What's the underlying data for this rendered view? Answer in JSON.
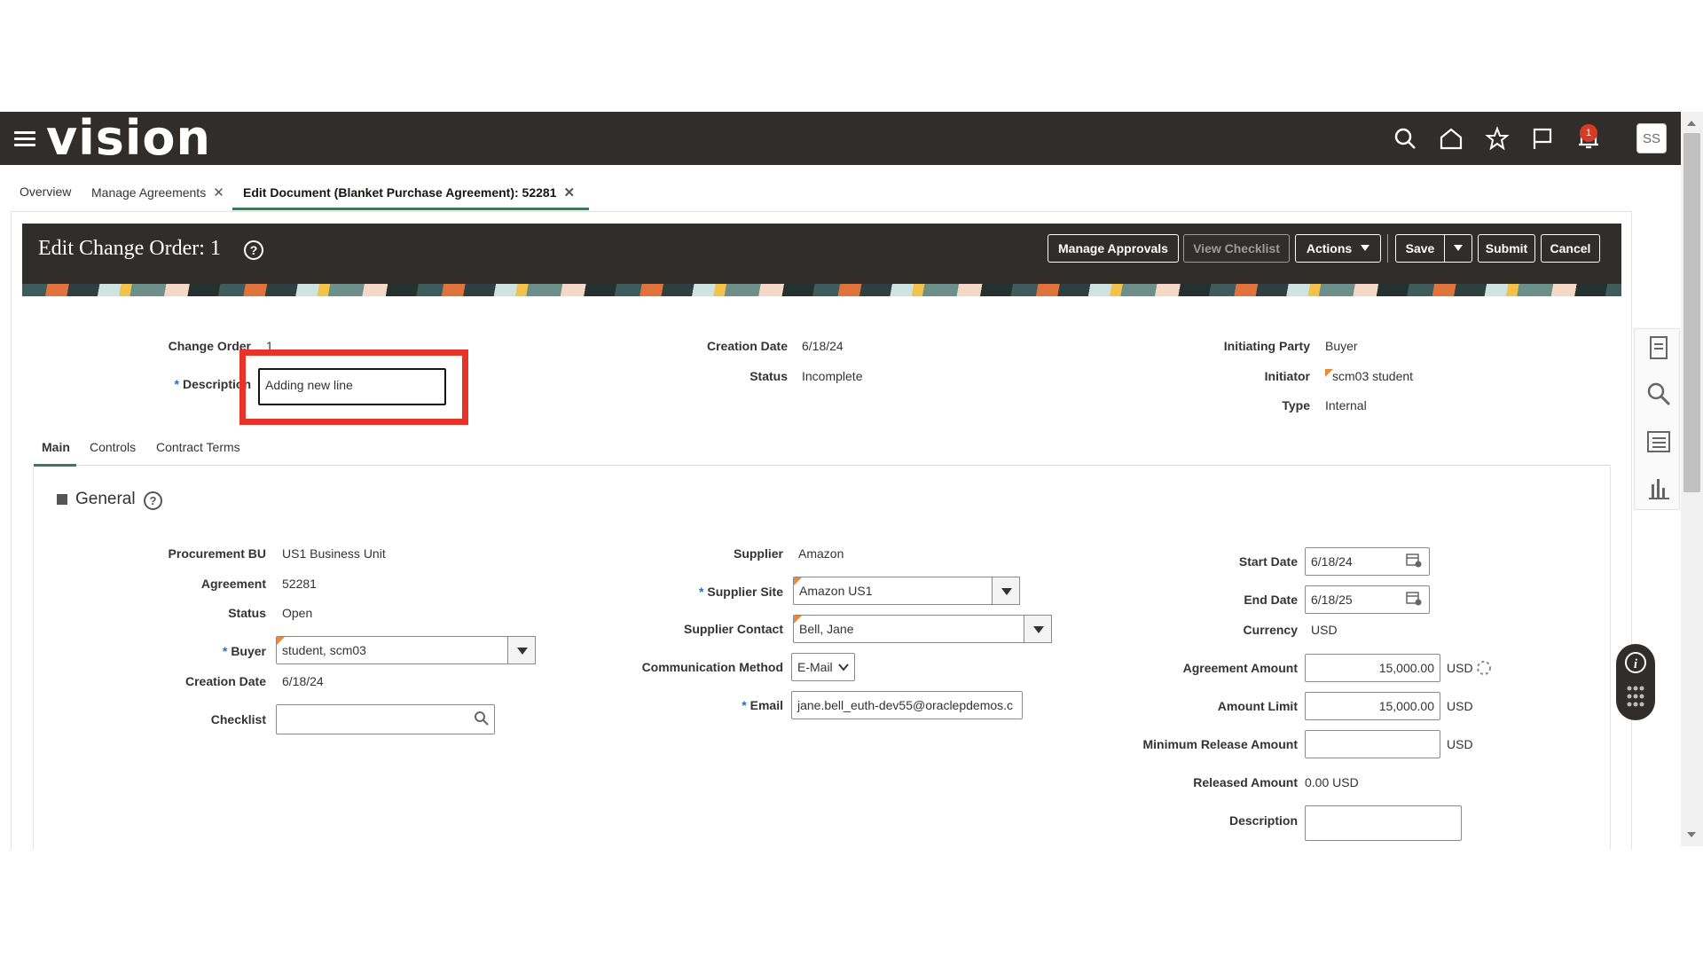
{
  "app": {
    "logo": "vision",
    "avatar_initials": "SS",
    "notification_count": "1"
  },
  "nav_tabs": [
    {
      "label": "Overview"
    },
    {
      "label": "Manage Agreements"
    },
    {
      "label": "Edit Document (Blanket Purchase Agreement): 52281"
    }
  ],
  "header": {
    "title": "Edit Change Order: 1",
    "buttons": {
      "manage_approvals": "Manage Approvals",
      "view_checklist": "View Checklist",
      "actions": "Actions",
      "save": "Save",
      "submit": "Submit",
      "cancel": "Cancel"
    }
  },
  "change_order": {
    "change_order_label": "Change Order",
    "change_order_value": "1",
    "description_label": "Description",
    "description_value": "Adding new line",
    "creation_date_label": "Creation Date",
    "creation_date_value": "6/18/24",
    "status_label": "Status",
    "status_value": "Incomplete",
    "initiating_party_label": "Initiating Party",
    "initiating_party_value": "Buyer",
    "initiator_label": "Initiator",
    "initiator_value": "scm03 student",
    "type_label": "Type",
    "type_value": "Internal"
  },
  "sub_tabs": [
    "Main",
    "Controls",
    "Contract Terms"
  ],
  "general": {
    "title": "General",
    "left": {
      "procurement_bu_label": "Procurement BU",
      "procurement_bu_value": "US1 Business Unit",
      "agreement_label": "Agreement",
      "agreement_value": "52281",
      "status_label": "Status",
      "status_value": "Open",
      "buyer_label": "Buyer",
      "buyer_value": "student, scm03",
      "creation_date_label": "Creation Date",
      "creation_date_value": "6/18/24",
      "checklist_label": "Checklist",
      "checklist_value": ""
    },
    "middle": {
      "supplier_label": "Supplier",
      "supplier_value": "Amazon",
      "supplier_site_label": "Supplier Site",
      "supplier_site_value": "Amazon US1",
      "supplier_contact_label": "Supplier Contact",
      "supplier_contact_value": "Bell, Jane",
      "communication_method_label": "Communication Method",
      "communication_method_value": "E-Mail",
      "email_label": "Email",
      "email_value": "jane.bell_euth-dev55@oraclepdemos.c"
    },
    "right": {
      "start_date_label": "Start Date",
      "start_date_value": "6/18/24",
      "end_date_label": "End Date",
      "end_date_value": "6/18/25",
      "currency_label": "Currency",
      "currency_value": "USD",
      "agreement_amount_label": "Agreement Amount",
      "agreement_amount_value": "15,000.00",
      "amount_limit_label": "Amount Limit",
      "amount_limit_value": "15,000.00",
      "min_release_label": "Minimum Release Amount",
      "min_release_value": "",
      "released_amount_label": "Released Amount",
      "released_amount_value": "0.00 USD",
      "description_label": "Description",
      "description_value": "",
      "usd": "USD"
    }
  },
  "colors": {
    "header_bg": "#312d2a",
    "accent_green": "#3d7a58",
    "highlight_red": "#e8332b",
    "required_blue": "#2a6ebb"
  }
}
